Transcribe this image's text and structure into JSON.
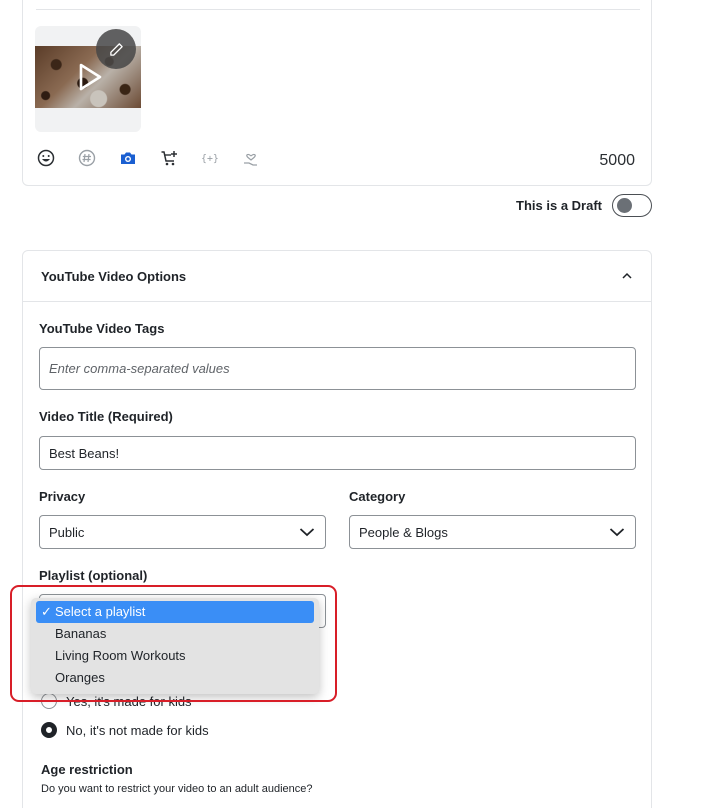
{
  "composer": {
    "char_count": "5000",
    "tools": [
      "emoji-icon",
      "hashtag-icon",
      "camera-icon",
      "cart-add-icon",
      "variable-icon",
      "hand-heart-icon"
    ],
    "accent": "#1a5fd1"
  },
  "draft": {
    "label": "This is a Draft",
    "enabled": false
  },
  "youtube": {
    "section_title": "YouTube Video Options",
    "tags": {
      "label": "YouTube Video Tags",
      "placeholder": "Enter comma-separated values",
      "value": ""
    },
    "title": {
      "label": "Video Title (Required)",
      "value": "Best Beans!"
    },
    "privacy": {
      "label": "Privacy",
      "selected": "Public"
    },
    "category": {
      "label": "Category",
      "selected": "People & Blogs"
    },
    "playlist": {
      "label": "Playlist (optional)",
      "options": [
        "Select a playlist",
        "Bananas",
        "Living Room Workouts",
        "Oranges"
      ],
      "selected_index": 0,
      "check_mark": "✓"
    },
    "made_for_kids": {
      "options": [
        "Yes, it's made for kids",
        "No, it's not made for kids"
      ],
      "selected_index": 1
    },
    "age_restriction": {
      "label": "Age restriction",
      "help": "Do you want to restrict your video to an adult audience?"
    }
  },
  "colors": {
    "highlight": "#d81e28",
    "selected_option": "#3a8ef6"
  }
}
